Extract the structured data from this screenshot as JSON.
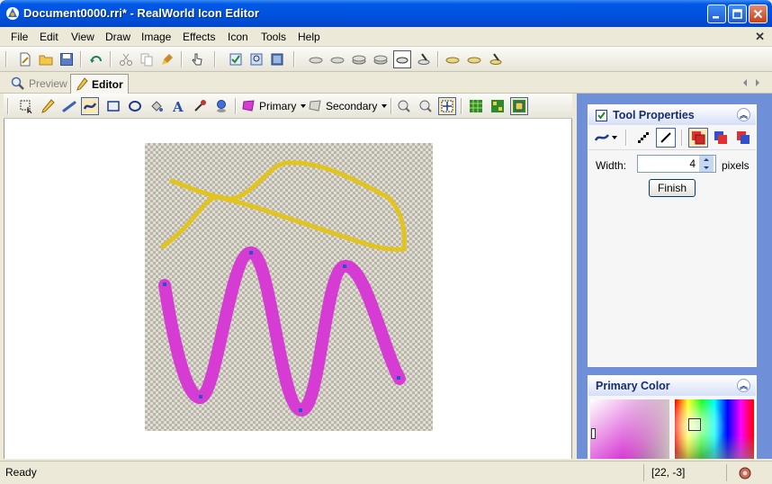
{
  "window": {
    "title": "Document0000.rri* - RealWorld Icon Editor"
  },
  "menu": {
    "items": [
      {
        "label": "File"
      },
      {
        "label": "Edit"
      },
      {
        "label": "View"
      },
      {
        "label": "Draw"
      },
      {
        "label": "Image"
      },
      {
        "label": "Effects"
      },
      {
        "label": "Icon"
      },
      {
        "label": "Tools"
      },
      {
        "label": "Help"
      }
    ],
    "close_glyph": "✕"
  },
  "tabs": {
    "preview": "Preview",
    "editor": "Editor"
  },
  "editor_toolbar": {
    "primary_label": "Primary",
    "secondary_label": "Secondary"
  },
  "tool_properties": {
    "title": "Tool Properties",
    "width_label": "Width:",
    "width_value": "4",
    "width_unit": "pixels",
    "finish_label": "Finish"
  },
  "primary_color": {
    "title": "Primary Color",
    "primary": "#D63CD3",
    "secondary": "#E6C800"
  },
  "status": {
    "text": "Ready",
    "coords": "[22, -3]"
  },
  "colors": {
    "title_bar": "#0054E3",
    "panel_bg": "#6F8FD8",
    "stroke_magenta": "#D63CD3",
    "stroke_yellow": "#E1C51E"
  }
}
